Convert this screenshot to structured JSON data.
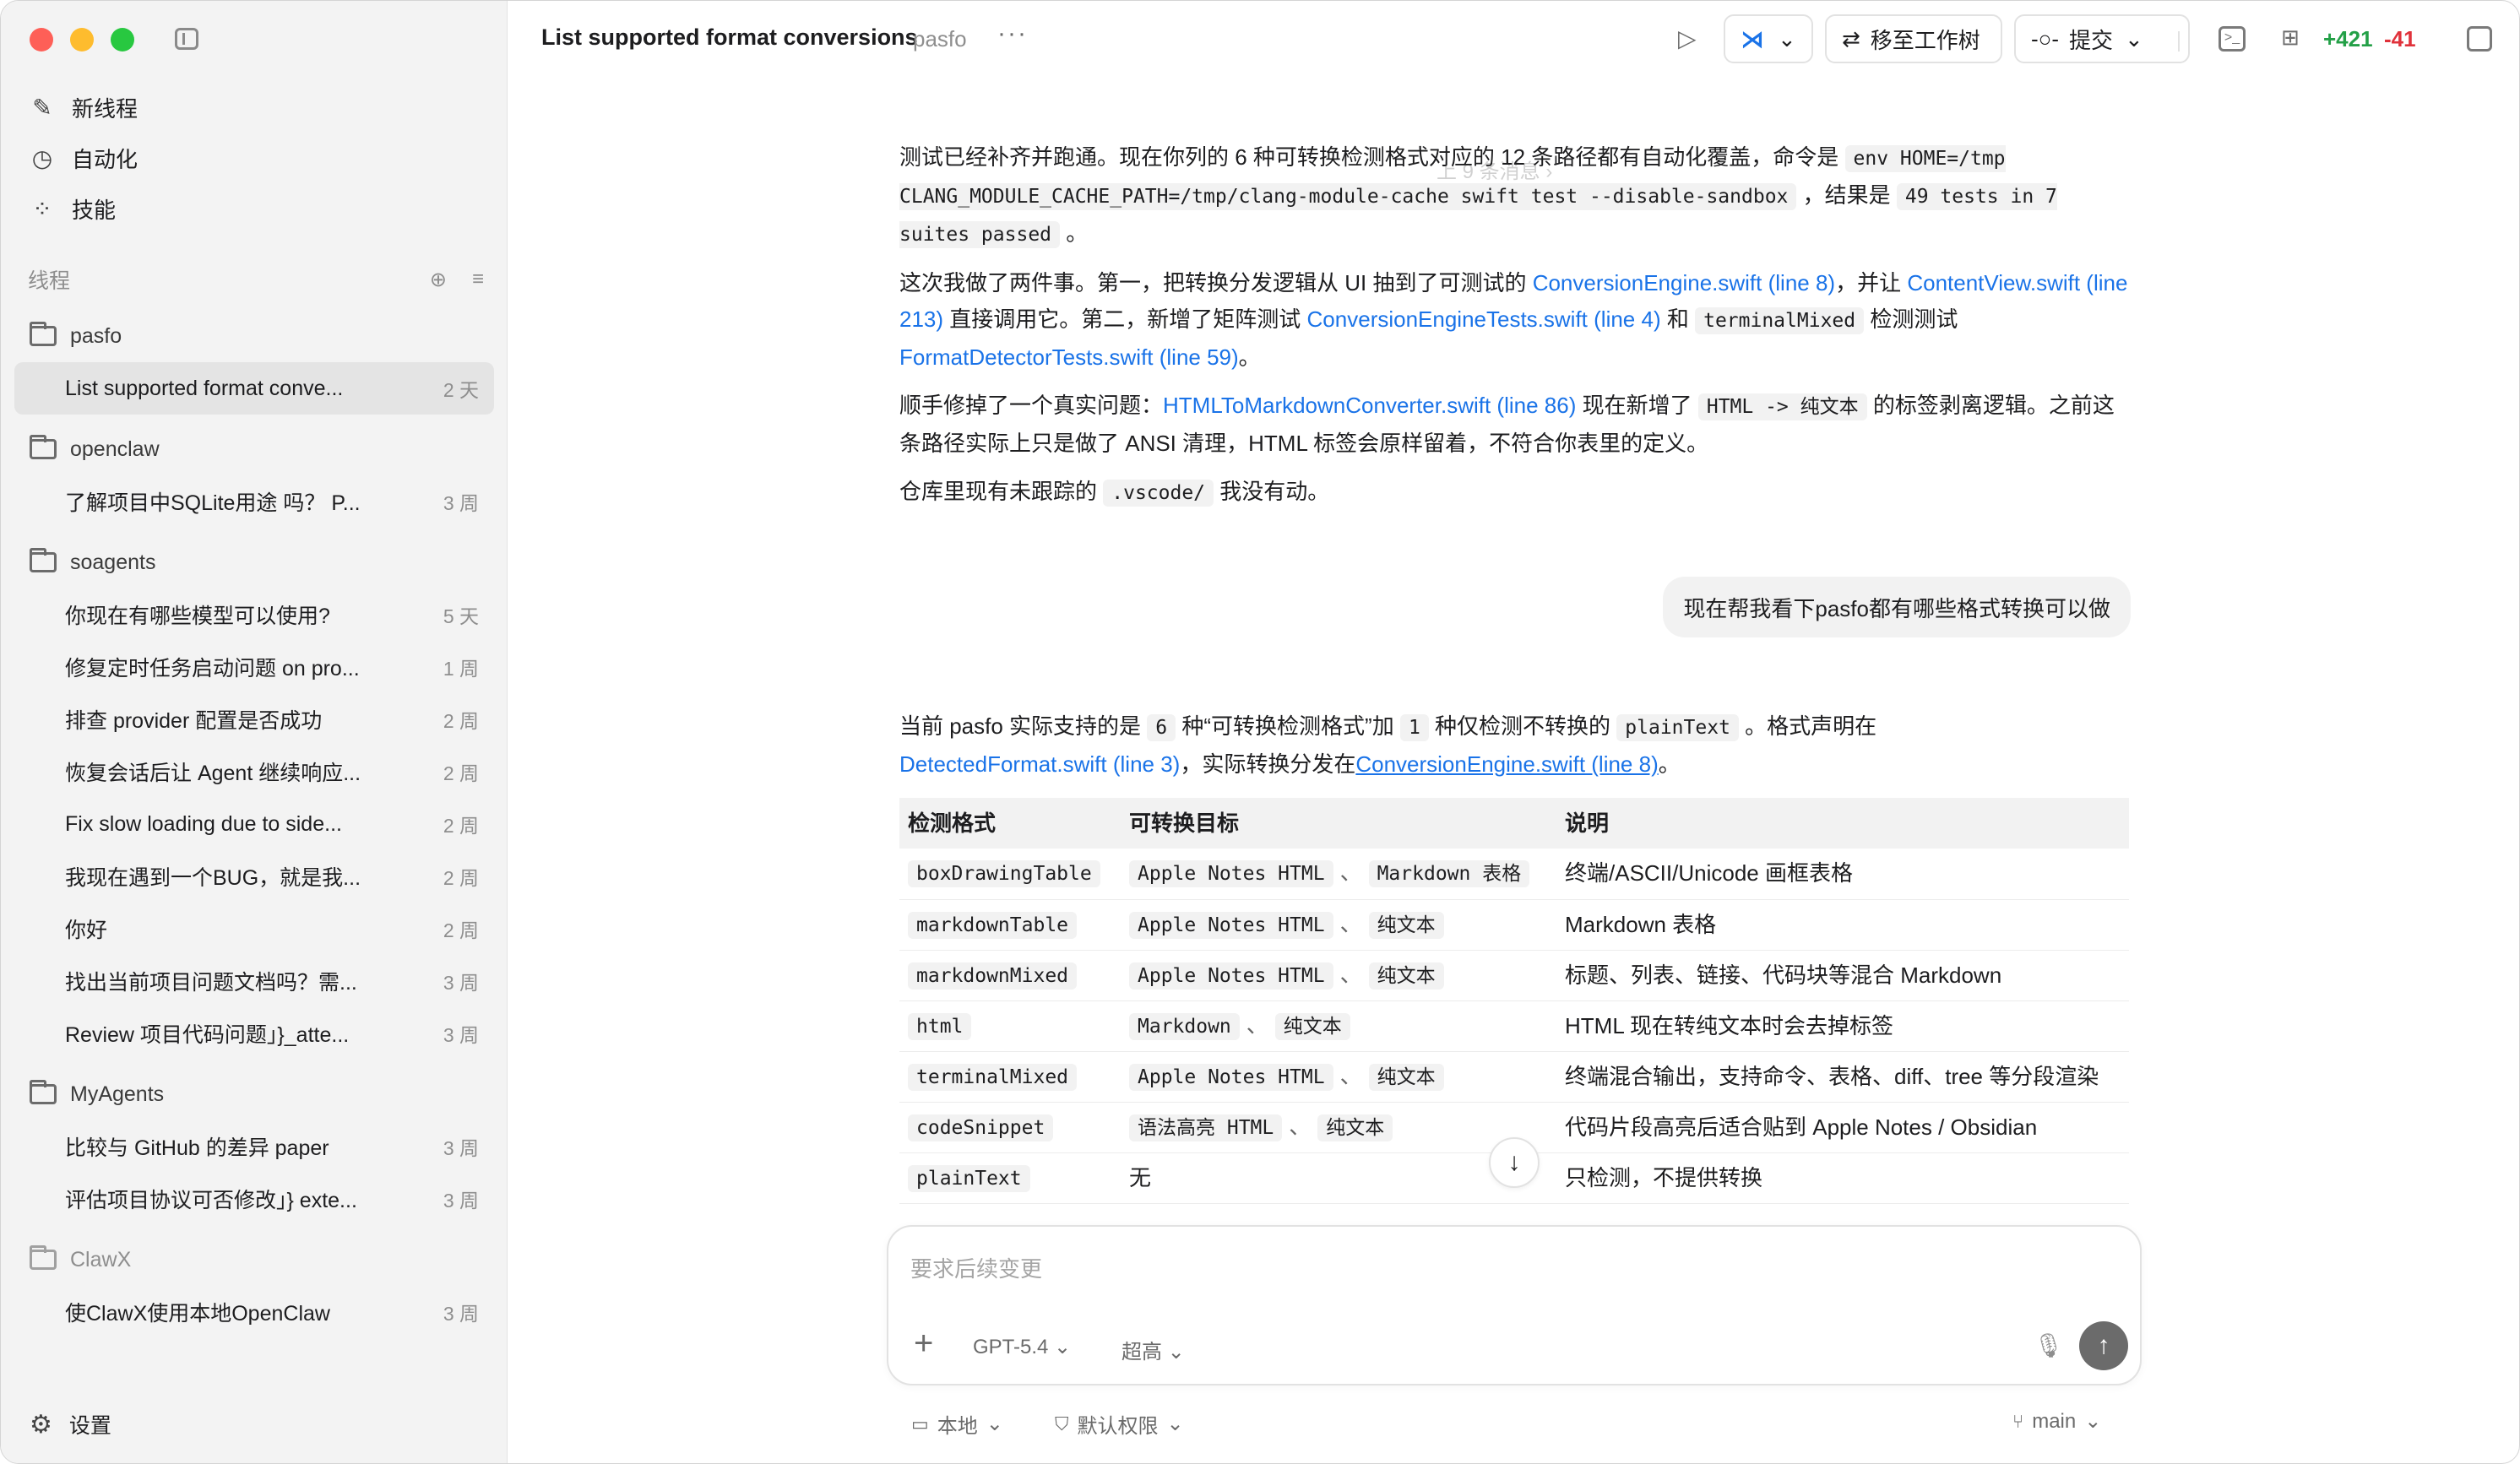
{
  "sidebar": {
    "nav": [
      {
        "label": "新线程",
        "icon": "compose-icon"
      },
      {
        "label": "自动化",
        "icon": "clock-icon"
      },
      {
        "label": "技能",
        "icon": "grid-icon"
      }
    ],
    "threads_label": "线程",
    "folders": [
      {
        "name": "pasfo",
        "threads": [
          {
            "title": "List supported format conve...",
            "age": "2 天",
            "active": true
          }
        ]
      },
      {
        "name": "openclaw",
        "threads": [
          {
            "title": "了解项目中SQLite用途 吗？ P...",
            "age": "3 周"
          }
        ]
      },
      {
        "name": "soagents",
        "threads": [
          {
            "title": "你现在有哪些模型可以使用?",
            "age": "5 天"
          },
          {
            "title": "修复定时任务启动问题 on pro...",
            "age": "1 周"
          },
          {
            "title": "排查 provider 配置是否成功",
            "age": "2 周"
          },
          {
            "title": "恢复会话后让 Agent 继续响应...",
            "age": "2 周"
          },
          {
            "title": "Fix slow loading due to side...",
            "age": "2 周"
          },
          {
            "title": "我现在遇到一个BUG，就是我...",
            "age": "2 周"
          },
          {
            "title": "你好",
            "age": "2 周"
          },
          {
            "title": "找出当前项目问题文档吗？需...",
            "age": "3 周"
          },
          {
            "title": "Review 项目代码问题」}_atte...",
            "age": "3 周"
          }
        ]
      },
      {
        "name": "MyAgents",
        "threads": [
          {
            "title": "比较与 GitHub 的差异 paper",
            "age": "3 周"
          },
          {
            "title": "评估项目协议可否修改」} exte...",
            "age": "3 周"
          }
        ]
      },
      {
        "name": "ClawX",
        "dim": true,
        "threads": [
          {
            "title": "使ClawX使用本地OpenClaw",
            "age": "3 周"
          }
        ]
      }
    ],
    "settings_label": "设置"
  },
  "topbar": {
    "title": "List supported format conversions",
    "project": "pasfo",
    "more": "···",
    "move_label": "移至工作树",
    "commit_label": "提交",
    "diff_add": "+421",
    "diff_del": "-41"
  },
  "chat": {
    "prev_messages": "上 9 条消息",
    "msg1": {
      "p1_a": "测试已经补齐并跑通。现在你列的 6 种可转换检测格式对应的 12 条路径都有自动化覆盖，命令是",
      "p1_code1": "env HOME=/tmp CLANG_MODULE_CACHE_PATH=/tmp/clang-module-cache swift test --disable-sandbox",
      "p1_b": "，结果是",
      "p1_code2": "49 tests in 7 suites passed",
      "p1_c": "。",
      "p2_a": "这次我做了两件事。第一，把转换分发逻辑从 UI 抽到了可测试的",
      "p2_link1": "ConversionEngine.swift (line 8)",
      "p2_b": "，并让",
      "p2_link2": "ContentView.swift (line 213)",
      "p2_c": "直接调用它。第二，新增了矩阵测试",
      "p2_link3": "ConversionEngineTests.swift (line 4)",
      "p2_d": "和",
      "p2_code": "terminalMixed",
      "p2_e": "检测测试",
      "p2_link4": "FormatDetectorTests.swift (line 59)",
      "p2_f": "。",
      "p3_a": "顺手修掉了一个真实问题：",
      "p3_link": "HTMLToMarkdownConverter.swift (line 86)",
      "p3_b": "现在新增了",
      "p3_code": "HTML -> 纯文本",
      "p3_c": "的标签剥离逻辑。之前这条路径实际上只是做了 ANSI 清理，HTML 标签会原样留着，不符合你表里的定义。",
      "p4_a": "仓库里现有未跟踪的",
      "p4_code": ".vscode/",
      "p4_b": "我没有动。"
    },
    "user_msg": "现在帮我看下pasfo都有哪些格式转换可以做",
    "msg2": {
      "a": "当前 pasfo 实际支持的是",
      "code1": "6",
      "b": "种“可转换检测格式”加",
      "code2": "1",
      "c": "种仅检测不转换的",
      "code3": "plainText",
      "d": "。格式声明在",
      "link1": "DetectedFormat.swift (line 3)",
      "e": "，实际转换分发在",
      "link2": "ConversionEngine.swift (line 8)",
      "f": "。"
    },
    "table": {
      "headers": [
        "检测格式",
        "可转换目标",
        "说明"
      ],
      "rows": [
        {
          "format": "boxDrawingTable",
          "targets": [
            "Apple Notes HTML",
            "Markdown 表格"
          ],
          "desc": "终端/ASCII/Unicode 画框表格"
        },
        {
          "format": "markdownTable",
          "targets": [
            "Apple Notes HTML",
            "纯文本"
          ],
          "desc": "Markdown 表格"
        },
        {
          "format": "markdownMixed",
          "targets": [
            "Apple Notes HTML",
            "纯文本"
          ],
          "desc": "标题、列表、链接、代码块等混合 Markdown"
        },
        {
          "format": "html",
          "targets": [
            "Markdown",
            "纯文本"
          ],
          "desc": "HTML 现在转纯文本时会去掉标签"
        },
        {
          "format": "terminalMixed",
          "targets": [
            "Apple Notes HTML",
            "纯文本"
          ],
          "desc": "终端混合输出，支持命令、表格、diff、tree 等分段渲染"
        },
        {
          "format": "codeSnippet",
          "targets": [
            "语法高亮 HTML",
            "纯文本"
          ],
          "desc": "代码片段高亮后适合贴到 Apple Notes / Obsidian"
        },
        {
          "format": "plainText",
          "targets_text": "无",
          "desc": "只检测，不提供转换"
        }
      ],
      "separator": "、"
    }
  },
  "composer": {
    "placeholder": "要求后续变更",
    "model": "GPT-5.4",
    "effort": "超高"
  },
  "footer": {
    "local": "本地",
    "permission": "默认权限",
    "branch": "main"
  },
  "colors": {
    "accent_link": "#1a73e8",
    "diff_add": "#23a047",
    "diff_del": "#e0323b",
    "sidebar_bg": "#f3f3f3"
  }
}
